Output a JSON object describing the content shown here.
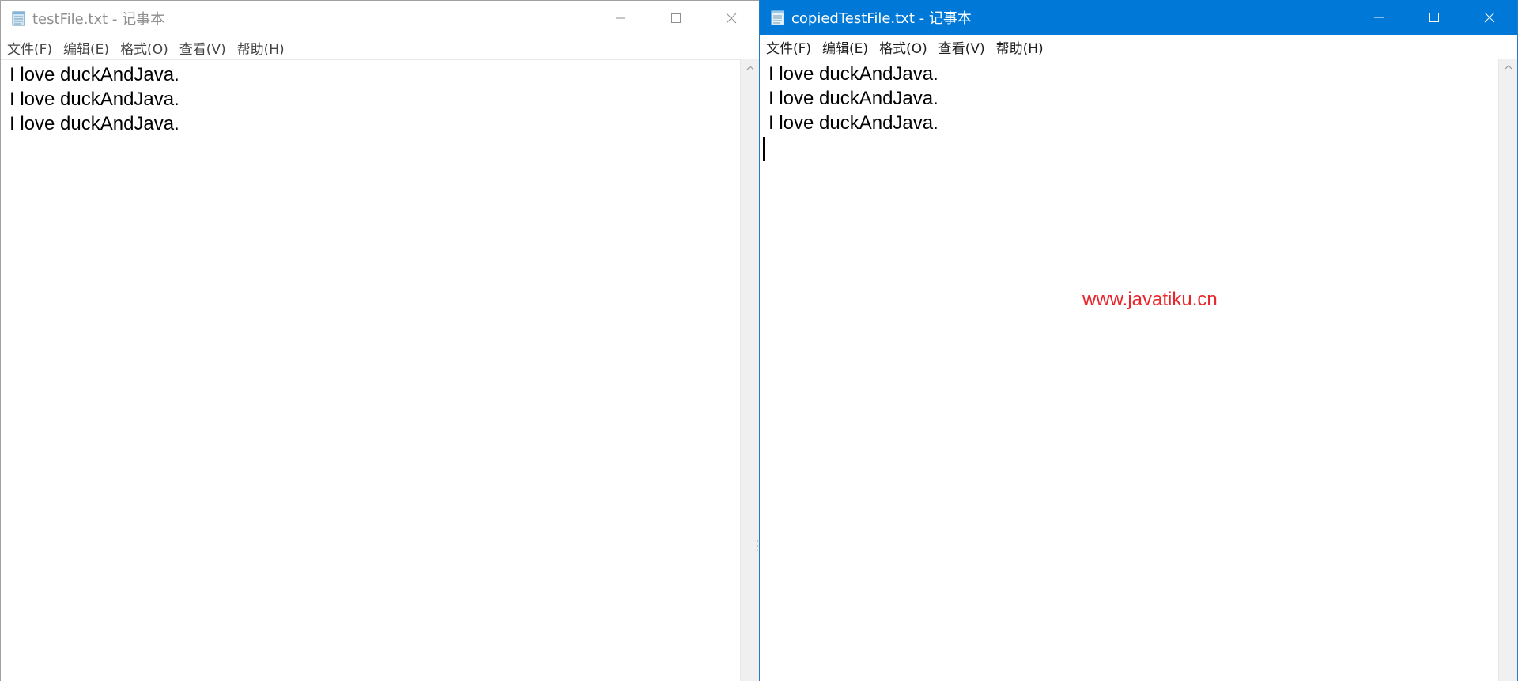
{
  "left_window": {
    "title": "testFile.txt - 记事本",
    "menu": [
      "文件(F)",
      "编辑(E)",
      "格式(O)",
      "查看(V)",
      "帮助(H)"
    ],
    "lines": [
      "I love duckAndJava.",
      "I love duckAndJava.",
      "I love duckAndJava."
    ],
    "icons": {
      "app": "notepad-icon",
      "minimize": "minimize-icon",
      "maximize": "maximize-icon",
      "close": "close-icon",
      "scroll_up": "chevron-up-icon"
    }
  },
  "right_window": {
    "title": "copiedTestFile.txt - 记事本",
    "menu": [
      "文件(F)",
      "编辑(E)",
      "格式(O)",
      "查看(V)",
      "帮助(H)"
    ],
    "lines": [
      "I love duckAndJava.",
      "I love duckAndJava.",
      "I love duckAndJava."
    ],
    "watermark": "www.javatiku.cn",
    "icons": {
      "app": "notepad-icon",
      "minimize": "minimize-icon",
      "maximize": "maximize-icon",
      "close": "close-icon",
      "scroll_up": "chevron-up-icon"
    }
  },
  "colors": {
    "active_titlebar": "#0078d7",
    "inactive_title_text": "#8e8e8e",
    "watermark": "#e8262c"
  }
}
